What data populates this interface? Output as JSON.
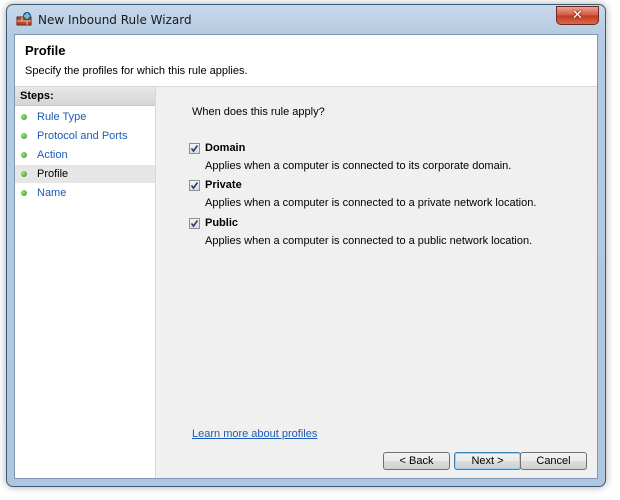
{
  "window": {
    "title": "New Inbound Rule Wizard",
    "close_glyph": "✕"
  },
  "header": {
    "title": "Profile",
    "subtitle": "Specify the profiles for which this rule applies."
  },
  "steps": {
    "heading": "Steps:",
    "items": [
      {
        "label": "Rule Type"
      },
      {
        "label": "Protocol and Ports"
      },
      {
        "label": "Action"
      },
      {
        "label": "Profile",
        "current": true
      },
      {
        "label": "Name"
      }
    ]
  },
  "content": {
    "question": "When does this rule apply?",
    "options": [
      {
        "name": "Domain",
        "checked": true,
        "description": "Applies when a computer is connected to its corporate domain."
      },
      {
        "name": "Private",
        "checked": true,
        "description": "Applies when a computer is connected to a private network location."
      },
      {
        "name": "Public",
        "checked": true,
        "description": "Applies when a computer is connected to a public network location."
      }
    ],
    "learn_more": "Learn more about profiles"
  },
  "buttons": {
    "back": "< Back",
    "next": "Next >",
    "cancel": "Cancel"
  },
  "colors": {
    "link": "#1c5bb7",
    "step_dot": "#2f9a16",
    "close_button": "#c23a20"
  }
}
